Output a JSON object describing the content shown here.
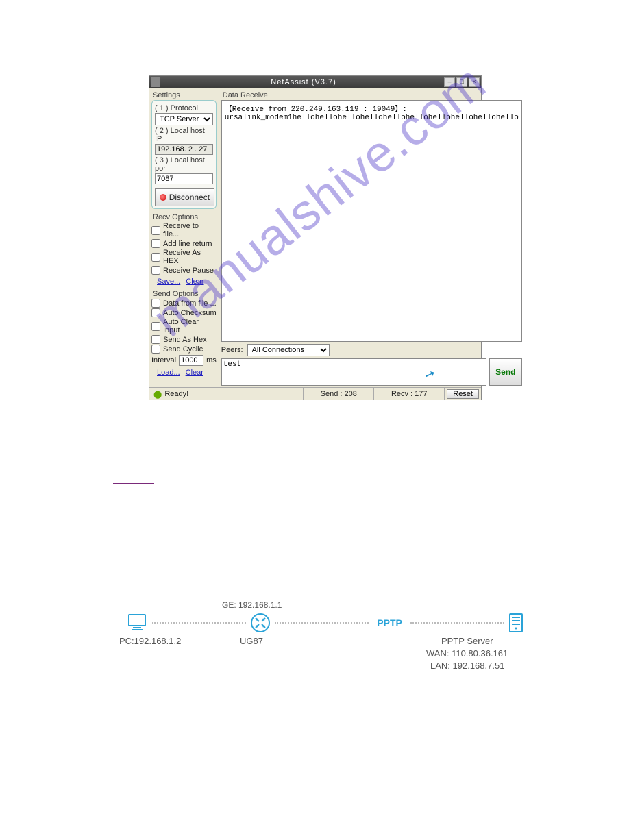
{
  "window": {
    "title": "NetAssist (V3.7)"
  },
  "settings": {
    "heading": "Settings",
    "protocol_label": "( 1 ) Protocol",
    "protocol_value": "TCP Server",
    "localip_label": "( 2 ) Local host IP",
    "localip_value": "192.168. 2 . 27",
    "localport_label": "( 3 ) Local host por",
    "localport_value": "7087",
    "disconnect_label": "Disconnect"
  },
  "recv_opts": {
    "heading": "Recv Options",
    "items": [
      "Receive to file...",
      "Add line return",
      "Receive As HEX",
      "Receive Pause"
    ],
    "save": "Save...",
    "clear": "Clear"
  },
  "send_opts": {
    "heading": "Send Options",
    "items": [
      "Data from file ...",
      "Auto Checksum",
      "Auto Clear Input",
      "Send As Hex",
      "Send Cyclic"
    ],
    "interval_label": "Interval",
    "interval_value": "1000",
    "interval_unit": "ms",
    "load": "Load...",
    "clear": "Clear"
  },
  "data_receive": {
    "heading": "Data Receive",
    "line1": "【Receive from 220.249.163.119 : 19049】:",
    "line2": "ursalink_modem1hellohellohellohellohellohellohellohellohellohello"
  },
  "peers": {
    "label": "Peers:",
    "value": "All Connections"
  },
  "send": {
    "text": "test",
    "button": "Send"
  },
  "status": {
    "ready": "Ready!",
    "send": "Send : 208",
    "recv": "Recv : 177",
    "reset": "Reset"
  },
  "watermark": "manualshive.com",
  "diagram": {
    "ge": "GE: 192.168.1.1",
    "pc": "PC:192.168.1.2",
    "router": "UG87",
    "pptp": "PPTP",
    "server": "PPTP Server",
    "wan": "WAN: 110.80.36.161",
    "lan": "LAN: 192.168.7.51"
  }
}
